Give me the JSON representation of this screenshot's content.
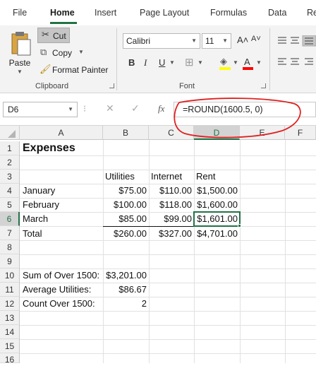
{
  "tabs": [
    "File",
    "Home",
    "Insert",
    "Page Layout",
    "Formulas",
    "Data",
    "Re"
  ],
  "clipboard": {
    "paste": "Paste",
    "cut": "Cut",
    "copy": "Copy",
    "format_painter": "Format Painter",
    "label": "Clipboard"
  },
  "font": {
    "name": "Calibri",
    "size": "11",
    "label": "Font",
    "bold": "B",
    "italic": "I",
    "underline": "U",
    "grow": "A˄",
    "shrink": "A˅",
    "color_letter": "A"
  },
  "name_box": "D6",
  "formula_bar": {
    "fx": "fx",
    "cancel": "✕",
    "enter": "✓",
    "formula": "=ROUND(1600.5, 0)"
  },
  "columns": [
    "A",
    "B",
    "C",
    "D",
    "E",
    "F"
  ],
  "rows": [
    "1",
    "2",
    "3",
    "4",
    "5",
    "6",
    "7",
    "8",
    "9",
    "10",
    "11",
    "12",
    "13",
    "14",
    "15",
    "16"
  ],
  "cells": {
    "a1": "Expenses",
    "b3": "Utilities",
    "c3": "Internet",
    "d3": "Rent",
    "a4": "January",
    "b4": "$75.00",
    "c4": "$110.00",
    "d4": "$1,500.00",
    "a5": "February",
    "b5": "$100.00",
    "c5": "$118.00",
    "d5": "$1,600.00",
    "a6": "March",
    "b6": "$85.00",
    "c6": "$99.00",
    "d6": "$1,601.00",
    "a7": "Total",
    "b7": "$260.00",
    "c7": "$327.00",
    "d7": "$4,701.00",
    "a10": "Sum of Over 1500:",
    "b10": "$3,201.00",
    "a11": "Average Utilities:",
    "b11": "$86.67",
    "a12": "Count Over 1500:",
    "b12": "2"
  },
  "colors": {
    "accent": "#217346",
    "annotation": "#e02020",
    "font_color": "#ff0000",
    "highlight": "#ffff00"
  }
}
